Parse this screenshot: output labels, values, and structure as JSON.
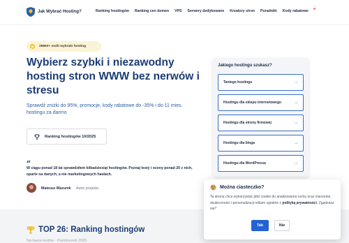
{
  "header": {
    "brand": "Jak Wybrać Hosting?",
    "nav": [
      "Ranking hostingów",
      "Ranking cen domen",
      "VPS",
      "Serwery dedykowane",
      "Kreatory stron",
      "Poradniki",
      "Kody rabatowe"
    ]
  },
  "hero": {
    "badge": "28863+ osób wybrało hosting",
    "title": "Wybierz szybki i niezawodny hosting stron WWW bez nerwów i stresu",
    "subtitle": "Sprawdź zniżki do 95%, promocje, kody rabatowe do -35% i do 11 mies. hostingu za darmo",
    "cta": "Ranking hostingów 10/2025",
    "quote_mark": "„",
    "quote": "W ciągu ponad 18 lat sprawdziłem kilkadziesiąt hostingów. Poznaj testy i oceny ponad 20 z nich, oparte na danych, a nie marketingowych hasłach.",
    "author_name": "Mateusz Mazurek",
    "author_role": "Autor projektu"
  },
  "finder": {
    "title": "Jakiego hostingu szukasz?",
    "options": [
      "Taniego hostingu",
      "Hostingu dla sklepu internetowego",
      "Hostingu dla strony firmowej",
      "Hostingu dla bloga",
      "Hostingu dla WordPressa"
    ],
    "arrow": "→"
  },
  "section": {
    "title": "TOP 26: Ranking hostingów",
    "subtitle": "Na bazie testów · Październik 2025"
  },
  "cookie": {
    "title": "Można ciasteczko?",
    "text_before": "Ta strona chce wykorzystać pliki cookie do analizowania ruchu oraz mierzenia skuteczności i personalizacji reklam zgodnie z ",
    "link": "polityką prywatności",
    "text_after": ". Zgadzasz się?",
    "accept": "Tak",
    "reject": "Nie"
  }
}
